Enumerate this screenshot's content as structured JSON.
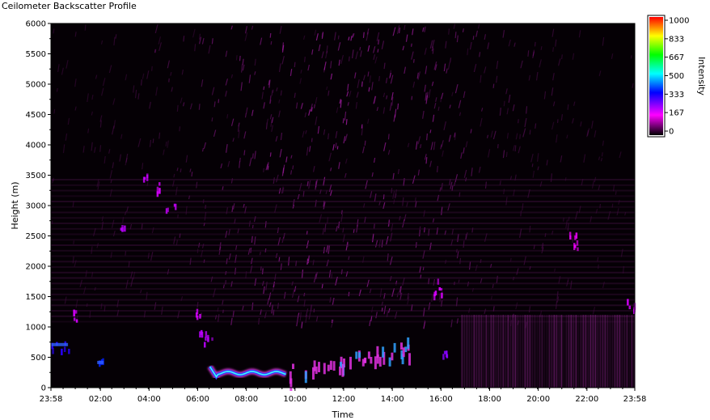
{
  "window": {
    "title": "Ceilometer Backscatter Profile"
  },
  "colors": {
    "plot_background": "#050005",
    "scale": [
      "#000000",
      "#ff00ff",
      "#0000ff",
      "#00ffff",
      "#00ff00",
      "#ffff00",
      "#ff0000"
    ]
  },
  "chart_data": {
    "type": "heatmap",
    "title": "Ceilometer Backscatter Profile",
    "xlabel": "Time",
    "ylabel": "Height (m)",
    "zlabel": "Intensity",
    "xlim": [
      -2,
      1438
    ],
    "ylim": [
      0,
      6000
    ],
    "zlim": [
      0,
      1000
    ],
    "x_ticks": [
      {
        "minute": -2,
        "label": "23:58"
      },
      {
        "minute": 120,
        "label": "02:00"
      },
      {
        "minute": 240,
        "label": "04:00"
      },
      {
        "minute": 360,
        "label": "06:00"
      },
      {
        "minute": 480,
        "label": "08:00"
      },
      {
        "minute": 600,
        "label": "10:00"
      },
      {
        "minute": 720,
        "label": "12:00"
      },
      {
        "minute": 840,
        "label": "14:00"
      },
      {
        "minute": 960,
        "label": "16:00"
      },
      {
        "minute": 1080,
        "label": "18:00"
      },
      {
        "minute": 1200,
        "label": "20:00"
      },
      {
        "minute": 1320,
        "label": "22:00"
      },
      {
        "minute": 1438,
        "label": "23:58"
      }
    ],
    "y_ticks": [
      0,
      500,
      1000,
      1500,
      2000,
      2500,
      3000,
      3500,
      4000,
      4500,
      5000,
      5500,
      6000
    ],
    "colorbar_ticks": [
      {
        "value": 1000,
        "label": "1000"
      },
      {
        "value": 833,
        "label": "833"
      },
      {
        "value": 667,
        "label": "667"
      },
      {
        "value": 500,
        "label": "500"
      },
      {
        "value": 333,
        "label": "333"
      },
      {
        "value": 167,
        "label": "167"
      },
      {
        "value": 0,
        "label": "0"
      }
    ],
    "features": [
      {
        "name": "low-layer-night",
        "x": [
          -2,
          40
        ],
        "y": [
          620,
          800
        ],
        "intensity": 330
      },
      {
        "name": "dot-1",
        "x": [
          112,
          128
        ],
        "y": [
          330,
          500
        ],
        "intensity": 380
      },
      {
        "name": "layer-0030",
        "x": [
          48,
          62
        ],
        "y": [
          1120,
          1320
        ],
        "intensity": 200
      },
      {
        "name": "layer-0300",
        "x": [
          165,
          185
        ],
        "y": [
          2620,
          2720
        ],
        "intensity": 220
      },
      {
        "name": "layer-0400",
        "x": [
          225,
          238
        ],
        "y": [
          3450,
          3550
        ],
        "intensity": 210
      },
      {
        "name": "layer-0420",
        "x": [
          255,
          265
        ],
        "y": [
          3150,
          3400
        ],
        "intensity": 200
      },
      {
        "name": "layer-0450",
        "x": [
          280,
          310
        ],
        "y": [
          2950,
          3080
        ],
        "intensity": 210
      },
      {
        "name": "layer-0615",
        "x": [
          350,
          365
        ],
        "y": [
          1180,
          1300
        ],
        "intensity": 200
      },
      {
        "name": "layer-0620",
        "x": [
          362,
          395
        ],
        "y": [
          700,
          1000
        ],
        "intensity": 220
      },
      {
        "name": "boundary-layer-morning",
        "x": [
          390,
          580
        ],
        "y": [
          80,
          320
        ],
        "intensity": 560
      },
      {
        "name": "boundary-layer-rise",
        "x": [
          580,
          880
        ],
        "y": [
          250,
          700
        ],
        "intensity": 380
      },
      {
        "name": "layer-1600",
        "x": [
          940,
          965
        ],
        "y": [
          1500,
          1800
        ],
        "intensity": 200
      },
      {
        "name": "layer-1630",
        "x": [
          960,
          975
        ],
        "y": [
          550,
          650
        ],
        "intensity": 260
      },
      {
        "name": "column-noise-evening",
        "x": [
          1010,
          1438
        ],
        "y": [
          0,
          1200
        ],
        "intensity": 60
      },
      {
        "name": "layer-2130",
        "x": [
          1270,
          1300
        ],
        "y": [
          2300,
          2600
        ],
        "intensity": 180
      },
      {
        "name": "layer-2350",
        "x": [
          1410,
          1438
        ],
        "y": [
          1300,
          1500
        ],
        "intensity": 200
      }
    ],
    "grid": false,
    "legend": "colorbar-right"
  }
}
